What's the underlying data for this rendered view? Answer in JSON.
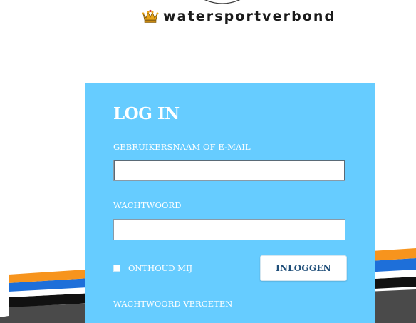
{
  "header": {
    "brand_name": "watersportverbond",
    "logo_icon": "crown-icon"
  },
  "login": {
    "title": "LOG IN",
    "username_label": "GEBRUIKERSNAAM OF E-MAIL",
    "username_value": "",
    "password_label": "WACHTWOORD",
    "password_value": "",
    "remember_label": "ONTHOUD MIJ",
    "remember_checked": false,
    "submit_label": "INLOGGEN",
    "forgot_label": "WACHTWOORD VERGETEN"
  },
  "colors": {
    "panel": "#66ccff",
    "stripe_orange": "#f7941d",
    "stripe_blue": "#1e6fd9",
    "stripe_dark": "#111111",
    "ground": "#4a4a4a",
    "button_text": "#1f4e79"
  }
}
